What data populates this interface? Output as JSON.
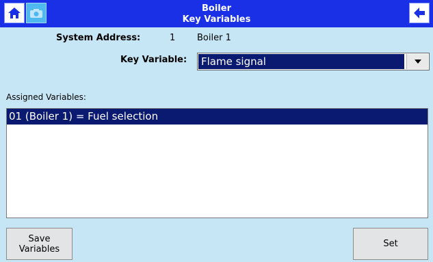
{
  "header": {
    "title_line1": "Boiler",
    "title_line2": "Key Variables",
    "home_icon": "home-icon",
    "camera_icon": "camera-icon",
    "back_icon": "back-arrow-icon",
    "bar_color": "#1a30e6"
  },
  "system": {
    "address_label": "System Address:",
    "address_value": "1",
    "device_name": "Boiler 1"
  },
  "key_variable": {
    "label": "Key Variable:",
    "selected": "Flame signal"
  },
  "assigned": {
    "label": "Assigned Variables:",
    "items": [
      "01 (Boiler 1) = Fuel selection"
    ]
  },
  "buttons": {
    "save_line1": "Save",
    "save_line2": "Variables",
    "set": "Set"
  },
  "colors": {
    "background": "#c6e6f6",
    "selection": "#0a1a70"
  }
}
